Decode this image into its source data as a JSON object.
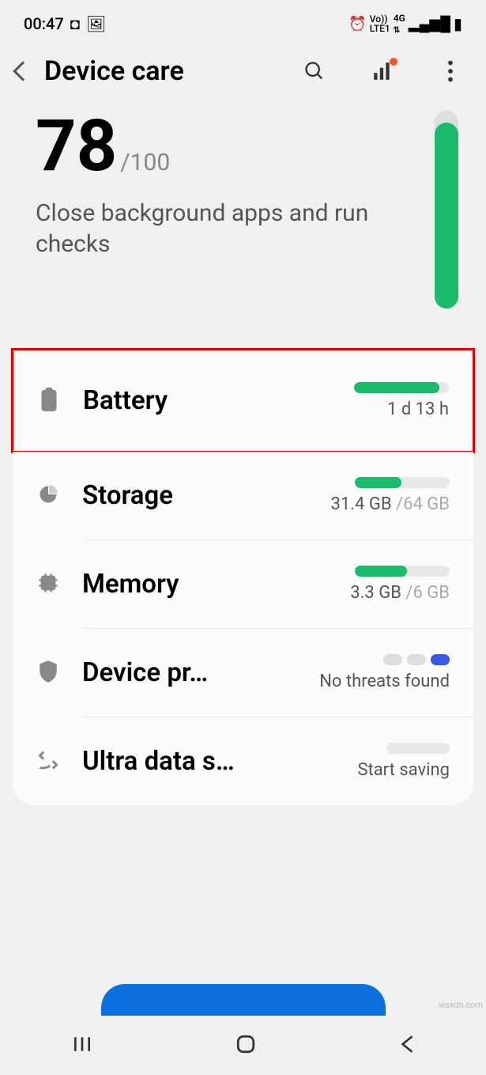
{
  "status_bar": {
    "time": "00:47",
    "network": "4G",
    "lte": "LTE1",
    "vo": "Vo))"
  },
  "header": {
    "title": "Device care"
  },
  "score": {
    "value": "78",
    "max": "/100",
    "subtitle": "Close background apps and run checks",
    "fill_pct": 94
  },
  "rows": {
    "battery": {
      "label": "Battery",
      "value": "1 d 13 h",
      "fill_pct": 90
    },
    "storage": {
      "label": "Storage",
      "used": "31.4 GB",
      "total": " /64 GB",
      "fill_pct": 49
    },
    "memory": {
      "label": "Memory",
      "used": "3.3 GB",
      "total": " /6 GB",
      "fill_pct": 55
    },
    "security": {
      "label": "Device pr…",
      "value": "No threats found"
    },
    "data": {
      "label": "Ultra data s…",
      "value": "Start saving"
    }
  },
  "watermark": "wsxdn.com"
}
